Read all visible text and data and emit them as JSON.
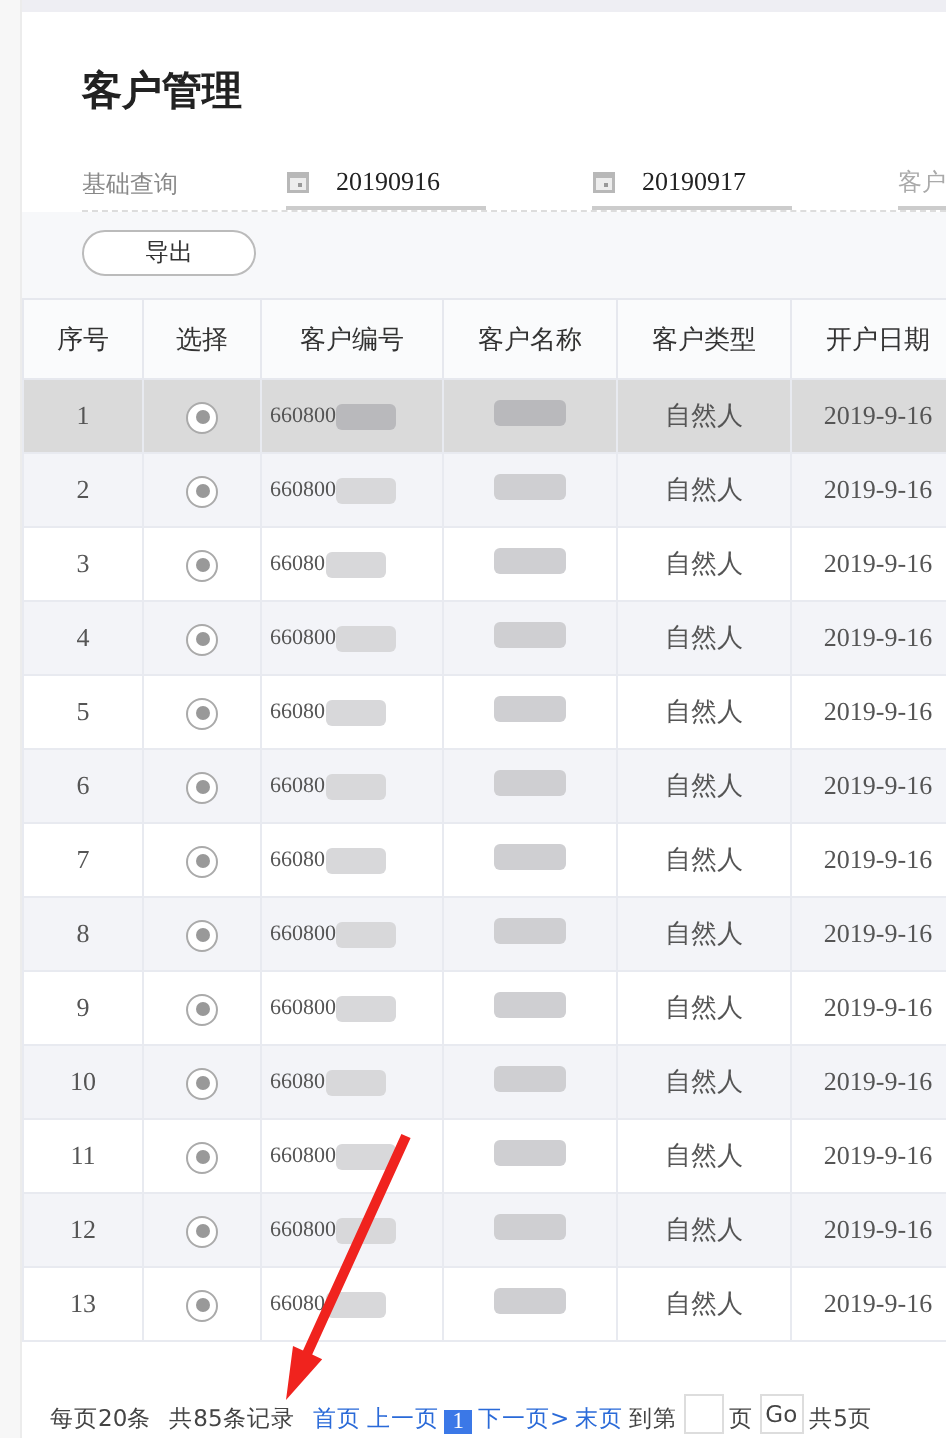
{
  "page": {
    "title": "客户管理"
  },
  "filter": {
    "label": "基础查询",
    "fields": [
      {
        "value": "20190916"
      },
      {
        "value": "20190917"
      }
    ],
    "cut_field": {
      "placeholder": "客户"
    }
  },
  "export_button": "导出",
  "table": {
    "columns": [
      "序号",
      "选择",
      "客户编号",
      "客户名称",
      "客户类型",
      "开户日期"
    ],
    "rows": [
      {
        "index": "1",
        "checked": true,
        "selected": true,
        "id": "660800",
        "type": "自然人",
        "date": "2019-9-16"
      },
      {
        "index": "2",
        "checked": true,
        "selected": false,
        "id": "660800",
        "type": "自然人",
        "date": "2019-9-16"
      },
      {
        "index": "3",
        "checked": true,
        "selected": false,
        "id": "66080",
        "type": "自然人",
        "date": "2019-9-16"
      },
      {
        "index": "4",
        "checked": true,
        "selected": false,
        "id": "660800",
        "type": "自然人",
        "date": "2019-9-16"
      },
      {
        "index": "5",
        "checked": true,
        "selected": false,
        "id": "66080",
        "type": "自然人",
        "date": "2019-9-16"
      },
      {
        "index": "6",
        "checked": true,
        "selected": false,
        "id": "66080",
        "type": "自然人",
        "date": "2019-9-16"
      },
      {
        "index": "7",
        "checked": true,
        "selected": false,
        "id": "66080",
        "type": "自然人",
        "date": "2019-9-16"
      },
      {
        "index": "8",
        "checked": true,
        "selected": false,
        "id": "660800",
        "type": "自然人",
        "date": "2019-9-16"
      },
      {
        "index": "9",
        "checked": true,
        "selected": false,
        "id": "660800",
        "type": "自然人",
        "date": "2019-9-16"
      },
      {
        "index": "10",
        "checked": true,
        "selected": false,
        "id": "66080",
        "type": "自然人",
        "date": "2019-9-16"
      },
      {
        "index": "11",
        "checked": true,
        "selected": false,
        "id": "660800",
        "type": "自然人",
        "date": "2019-9-16"
      },
      {
        "index": "12",
        "checked": true,
        "selected": false,
        "id": "660800",
        "type": "自然人",
        "date": "2019-9-16"
      },
      {
        "index": "13",
        "checked": true,
        "selected": false,
        "id": "66080",
        "type": "自然人",
        "date": "2019-9-16"
      }
    ]
  },
  "pagination": {
    "per_page": "每页20条",
    "total": "共85条记录",
    "links": [
      {
        "label": "首页"
      },
      {
        "label": "上一页"
      }
    ],
    "pages": [
      {
        "label": "1",
        "selected": true
      }
    ],
    "links_after": [
      {
        "label": "下一页>"
      },
      {
        "label": "末页"
      }
    ],
    "goto_label": "到第",
    "page_unit": "页",
    "go_button": "Go",
    "page_count": "共5页"
  }
}
